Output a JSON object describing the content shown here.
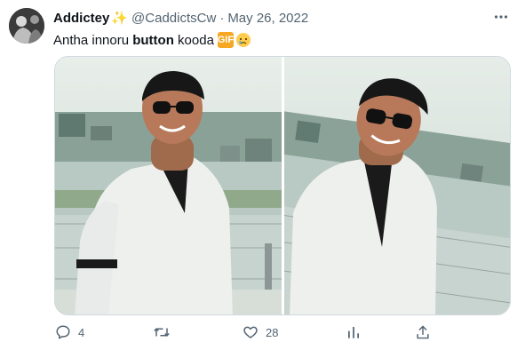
{
  "author": {
    "display_name": "Addictey",
    "handle": "@CaddictsCw",
    "separator": "·",
    "date": "May 26, 2022"
  },
  "tweet": {
    "text_before": "Antha innoru ",
    "text_bold": "button",
    "text_after": " kooda",
    "emoji_box": "GIF"
  },
  "media": {
    "images": [
      "photo-left",
      "photo-right"
    ]
  },
  "actions": {
    "reply_count": "4",
    "retweet_count": "",
    "like_count": "28",
    "views_count": ""
  },
  "colors": {
    "text_primary": "#0f1419",
    "text_secondary": "#536471",
    "border": "#cfd9de",
    "sparkle": "#f4b400"
  },
  "icons": {
    "more": "more-horizontal-icon",
    "reply": "reply-icon",
    "retweet": "retweet-icon",
    "like": "heart-icon",
    "views": "analytics-icon",
    "share": "share-icon"
  }
}
